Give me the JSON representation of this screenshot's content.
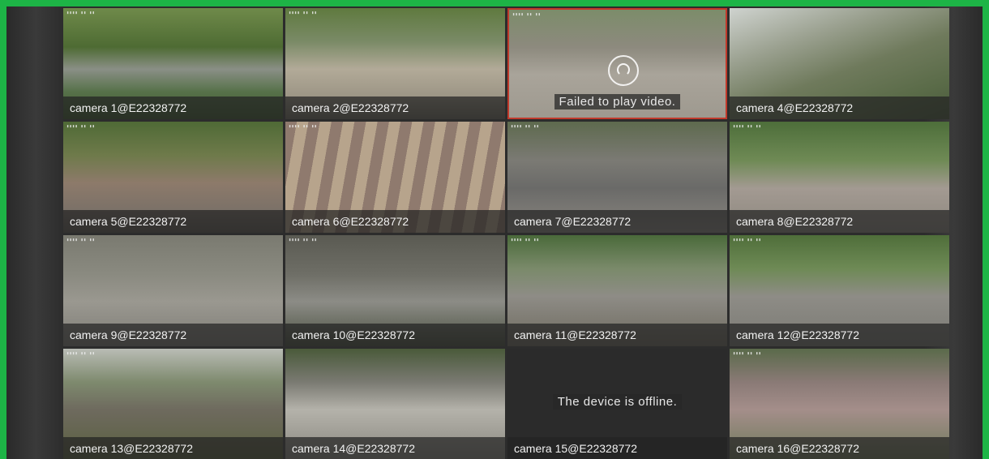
{
  "cameras": [
    {
      "label": "camera 1@E22328772",
      "status": "live"
    },
    {
      "label": "camera 2@E22328772",
      "status": "live"
    },
    {
      "label": "",
      "status": "failed",
      "message": "Failed to play video."
    },
    {
      "label": "camera 4@E22328772",
      "status": "live"
    },
    {
      "label": "camera 5@E22328772",
      "status": "live"
    },
    {
      "label": "camera 6@E22328772",
      "status": "live"
    },
    {
      "label": "camera 7@E22328772",
      "status": "live"
    },
    {
      "label": "camera 8@E22328772",
      "status": "live"
    },
    {
      "label": "camera 9@E22328772",
      "status": "live"
    },
    {
      "label": "camera 10@E22328772",
      "status": "live"
    },
    {
      "label": "camera 11@E22328772",
      "status": "live"
    },
    {
      "label": "camera 12@E22328772",
      "status": "live"
    },
    {
      "label": "camera 13@E22328772",
      "status": "live"
    },
    {
      "label": "camera 14@E22328772",
      "status": "live"
    },
    {
      "label": "camera 15@E22328772",
      "status": "offline",
      "message": "The device is offline."
    },
    {
      "label": "camera 16@E22328772",
      "status": "live"
    }
  ],
  "colors": {
    "border": "#1db446",
    "failed_border": "#c0392b"
  }
}
